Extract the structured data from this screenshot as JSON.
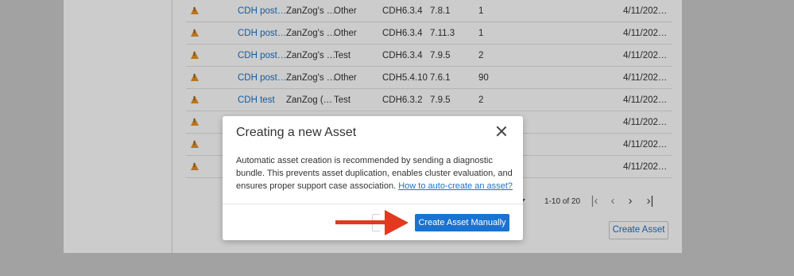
{
  "table": {
    "rows": [
      {
        "name": "CDH post…",
        "org": "ZanZog's …",
        "type": "Other",
        "cdh": "CDH6.3.4",
        "version": "7.8.1",
        "count": "1",
        "date": "4/11/202…"
      },
      {
        "name": "CDH post…",
        "org": "ZanZog's …",
        "type": "Other",
        "cdh": "CDH6.3.4",
        "version": "7.11.3",
        "count": "1",
        "date": "4/11/202…"
      },
      {
        "name": "CDH post…",
        "org": "ZanZog's …",
        "type": "Test",
        "cdh": "CDH6.3.4",
        "version": "7.9.5",
        "count": "2",
        "date": "4/11/202…"
      },
      {
        "name": "CDH post…",
        "org": "ZanZog's …",
        "type": "Other",
        "cdh": "CDH5.4.10",
        "version": "7.6.1",
        "count": "90",
        "date": "4/11/202…"
      },
      {
        "name": "CDH test",
        "org": "ZanZog (…",
        "type": "Test",
        "cdh": "CDH6.3.2",
        "version": "7.9.5",
        "count": "2",
        "date": "4/11/202…"
      },
      {
        "name": "",
        "org": "",
        "type": "",
        "cdh": "",
        "version": "",
        "count": "",
        "date": "4/11/202…"
      },
      {
        "name": "",
        "org": "",
        "type": "",
        "cdh": "",
        "version": "",
        "count": "",
        "date": "4/11/202…"
      },
      {
        "name": "",
        "org": "",
        "type": "",
        "cdh": "",
        "version": "",
        "count": "",
        "date": "4/11/202…"
      }
    ]
  },
  "pagination": {
    "range": "1-10 of 20",
    "first": "|‹",
    "prev": "‹",
    "next": "›",
    "last": "›|"
  },
  "page": {
    "create_asset_label": "Create Asset"
  },
  "modal": {
    "title": "Creating a new Asset",
    "body": "Automatic asset creation is recommended by sending a diagnostic bundle. This prevents asset duplication, enables cluster evaluation, and ensures proper support case association.",
    "link": "How to auto-create an asset?",
    "primary_button": "Create Asset Manually"
  },
  "colors": {
    "accent": "#1a73d0",
    "warning": "#e8912a",
    "arrow": "#e2391f"
  },
  "icons": {
    "row_status": "warning-icon",
    "close": "close-icon",
    "annotation": "red-arrow-annotation"
  }
}
